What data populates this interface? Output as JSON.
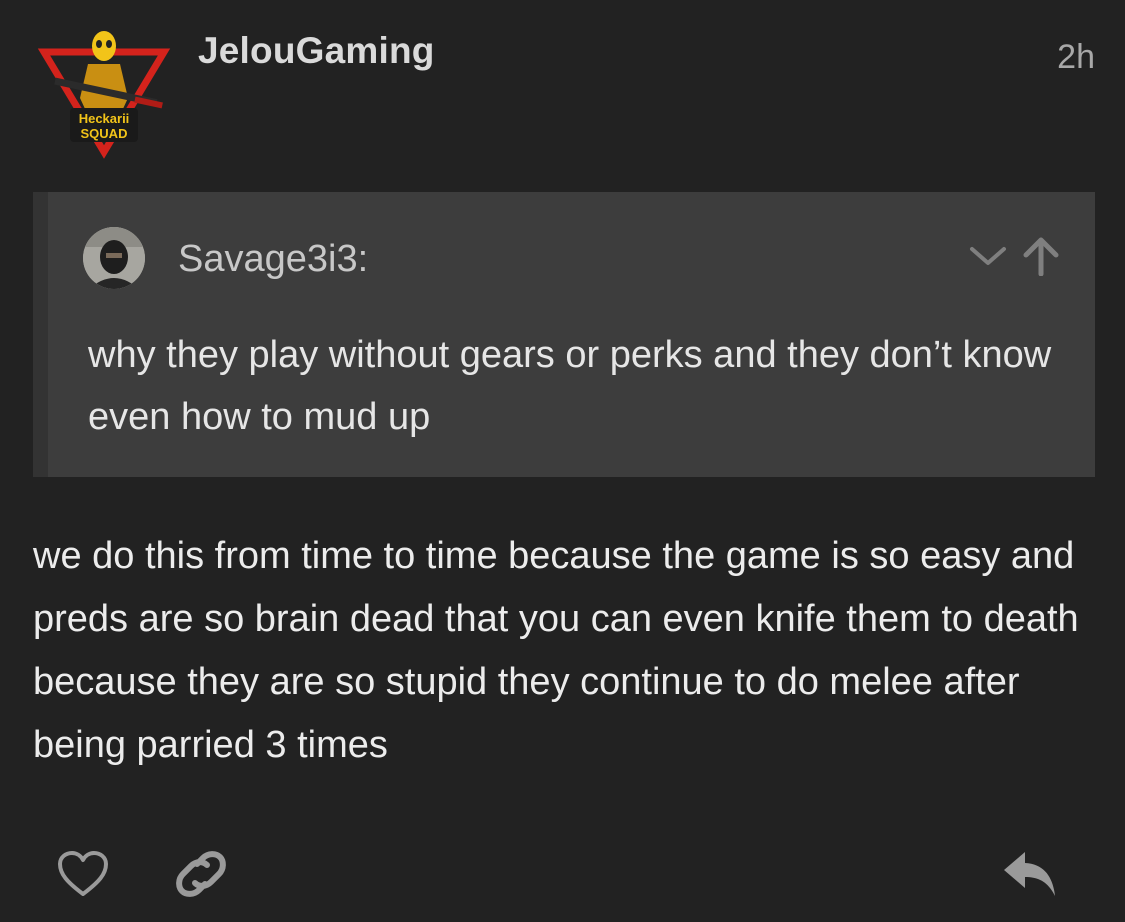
{
  "post": {
    "author": "JelouGaming",
    "timestamp": "2h",
    "avatar_logo_text": [
      "Heckarii",
      "SQUAD"
    ],
    "quote": {
      "author": "Savage3i3:",
      "text": "why they play without gears or perks and they don’t know even how to mud up",
      "controls": {
        "expand_icon": "chevron-down-icon",
        "jump_icon": "arrow-up-icon"
      }
    },
    "body": "we do this from time to time because the game is so easy and preds are so brain dead that you can even knife them to death because they are so stupid they continue to do melee after being parried 3 times",
    "actions": {
      "like_icon": "heart-icon",
      "share_icon": "link-icon",
      "reply_icon": "reply-icon"
    }
  },
  "colors": {
    "background": "#222222",
    "quote_background": "#3d3d3d",
    "logo_red": "#d4231c",
    "logo_yellow": "#f2c419"
  }
}
